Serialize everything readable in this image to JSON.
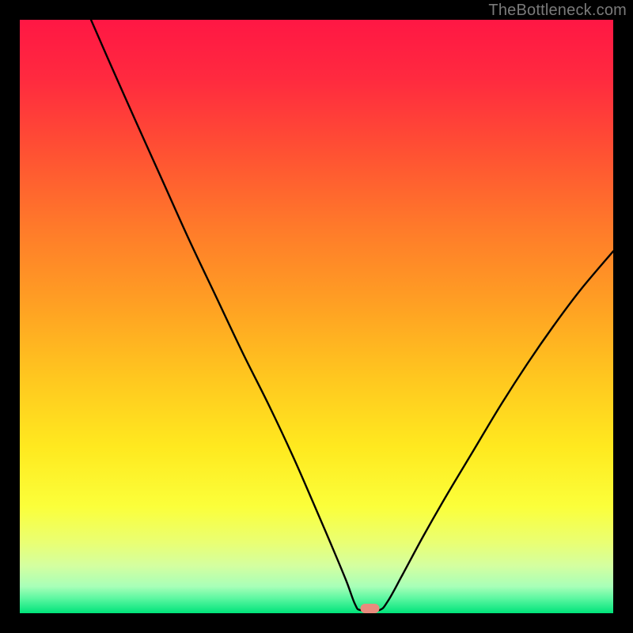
{
  "watermark": "TheBottleneck.com",
  "gradient": {
    "stops": [
      {
        "offset": 0.0,
        "color": "#ff1744"
      },
      {
        "offset": 0.1,
        "color": "#ff2a3f"
      },
      {
        "offset": 0.22,
        "color": "#ff5033"
      },
      {
        "offset": 0.35,
        "color": "#ff7a2a"
      },
      {
        "offset": 0.48,
        "color": "#ffa023"
      },
      {
        "offset": 0.6,
        "color": "#ffc61f"
      },
      {
        "offset": 0.72,
        "color": "#ffe91f"
      },
      {
        "offset": 0.82,
        "color": "#fbff3a"
      },
      {
        "offset": 0.88,
        "color": "#eaff72"
      },
      {
        "offset": 0.92,
        "color": "#d4ffa0"
      },
      {
        "offset": 0.955,
        "color": "#a8ffb8"
      },
      {
        "offset": 0.975,
        "color": "#5cf7a1"
      },
      {
        "offset": 1.0,
        "color": "#00e37a"
      }
    ]
  },
  "chart_data": {
    "type": "line",
    "title": "",
    "xlabel": "",
    "ylabel": "",
    "xlim": [
      0,
      100
    ],
    "ylim": [
      0,
      100
    ],
    "marker": {
      "x_pct": 59,
      "y_pct": 0
    },
    "series": [
      {
        "name": "bottleneck-curve",
        "points": [
          {
            "x_pct": 12.0,
            "y_pct": 100.0
          },
          {
            "x_pct": 15.5,
            "y_pct": 92.0
          },
          {
            "x_pct": 19.5,
            "y_pct": 83.0
          },
          {
            "x_pct": 24.0,
            "y_pct": 73.0
          },
          {
            "x_pct": 28.5,
            "y_pct": 63.0
          },
          {
            "x_pct": 33.0,
            "y_pct": 53.5
          },
          {
            "x_pct": 37.5,
            "y_pct": 44.0
          },
          {
            "x_pct": 42.0,
            "y_pct": 35.0
          },
          {
            "x_pct": 46.0,
            "y_pct": 26.5
          },
          {
            "x_pct": 49.5,
            "y_pct": 18.5
          },
          {
            "x_pct": 52.5,
            "y_pct": 11.5
          },
          {
            "x_pct": 55.0,
            "y_pct": 5.5
          },
          {
            "x_pct": 56.5,
            "y_pct": 1.5
          },
          {
            "x_pct": 57.5,
            "y_pct": 0.5
          },
          {
            "x_pct": 60.5,
            "y_pct": 0.5
          },
          {
            "x_pct": 62.0,
            "y_pct": 2.0
          },
          {
            "x_pct": 64.5,
            "y_pct": 6.5
          },
          {
            "x_pct": 68.0,
            "y_pct": 13.0
          },
          {
            "x_pct": 72.0,
            "y_pct": 20.0
          },
          {
            "x_pct": 76.5,
            "y_pct": 27.5
          },
          {
            "x_pct": 81.0,
            "y_pct": 35.0
          },
          {
            "x_pct": 85.5,
            "y_pct": 42.0
          },
          {
            "x_pct": 90.0,
            "y_pct": 48.5
          },
          {
            "x_pct": 94.5,
            "y_pct": 54.5
          },
          {
            "x_pct": 100.0,
            "y_pct": 61.0
          }
        ]
      }
    ]
  }
}
